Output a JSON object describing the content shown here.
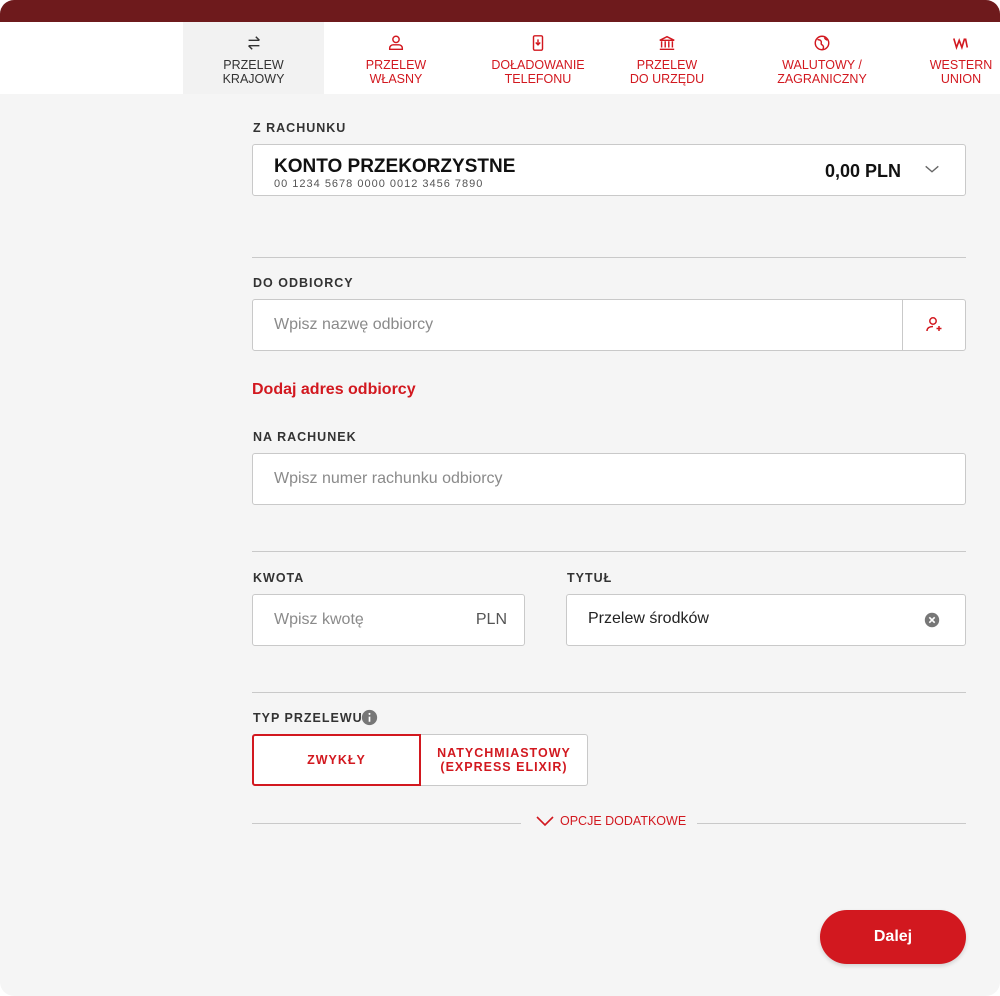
{
  "tabs": [
    {
      "label": "PRZELEW\nKRAJOWY",
      "icon": "transfer-arrows-icon",
      "active": true
    },
    {
      "label": "PRZELEW\nWŁASNY",
      "icon": "person-icon",
      "active": false
    },
    {
      "label": "DOŁADOWANIE\nTELEFONU",
      "icon": "phone-topup-icon",
      "active": false
    },
    {
      "label": "PRZELEW\nDO URZĘDU",
      "icon": "bank-building-icon",
      "active": false
    },
    {
      "label": "WALUTOWY /\nZAGRANICZNY",
      "icon": "globe-icon",
      "active": false
    },
    {
      "label": "WESTERN\nUNION",
      "icon": "western-union-icon",
      "active": false
    }
  ],
  "from_account": {
    "label": "Z RACHUNKU",
    "name": "KONTO PRZEKORZYSTNE",
    "number": "00 1234 5678 0000 0012 3456 7890",
    "balance": "0,00 PLN"
  },
  "recipient": {
    "label": "DO ODBIORCY",
    "placeholder": "Wpisz nazwę odbiorcy",
    "add_address_link": "Dodaj adres odbiorcy"
  },
  "to_account": {
    "label": "NA RACHUNEK",
    "placeholder": "Wpisz numer rachunku odbiorcy"
  },
  "amount": {
    "label": "KWOTA",
    "placeholder": "Wpisz kwotę",
    "currency": "PLN"
  },
  "title": {
    "label": "TYTUŁ",
    "value": "Przelew środków"
  },
  "transfer_type": {
    "label": "TYP PRZELEWU",
    "options": [
      "ZWYKŁY",
      "NATYCHMIASTOWY\n(EXPRESS ELIXIR)"
    ],
    "selected": "ZWYKŁY"
  },
  "extra_options_label": "OPCJE DODATKOWE",
  "next_button": "Dalej",
  "colors": {
    "accent": "#d2181f",
    "topbar": "#6e1a1c",
    "background": "#f5f5f5"
  }
}
